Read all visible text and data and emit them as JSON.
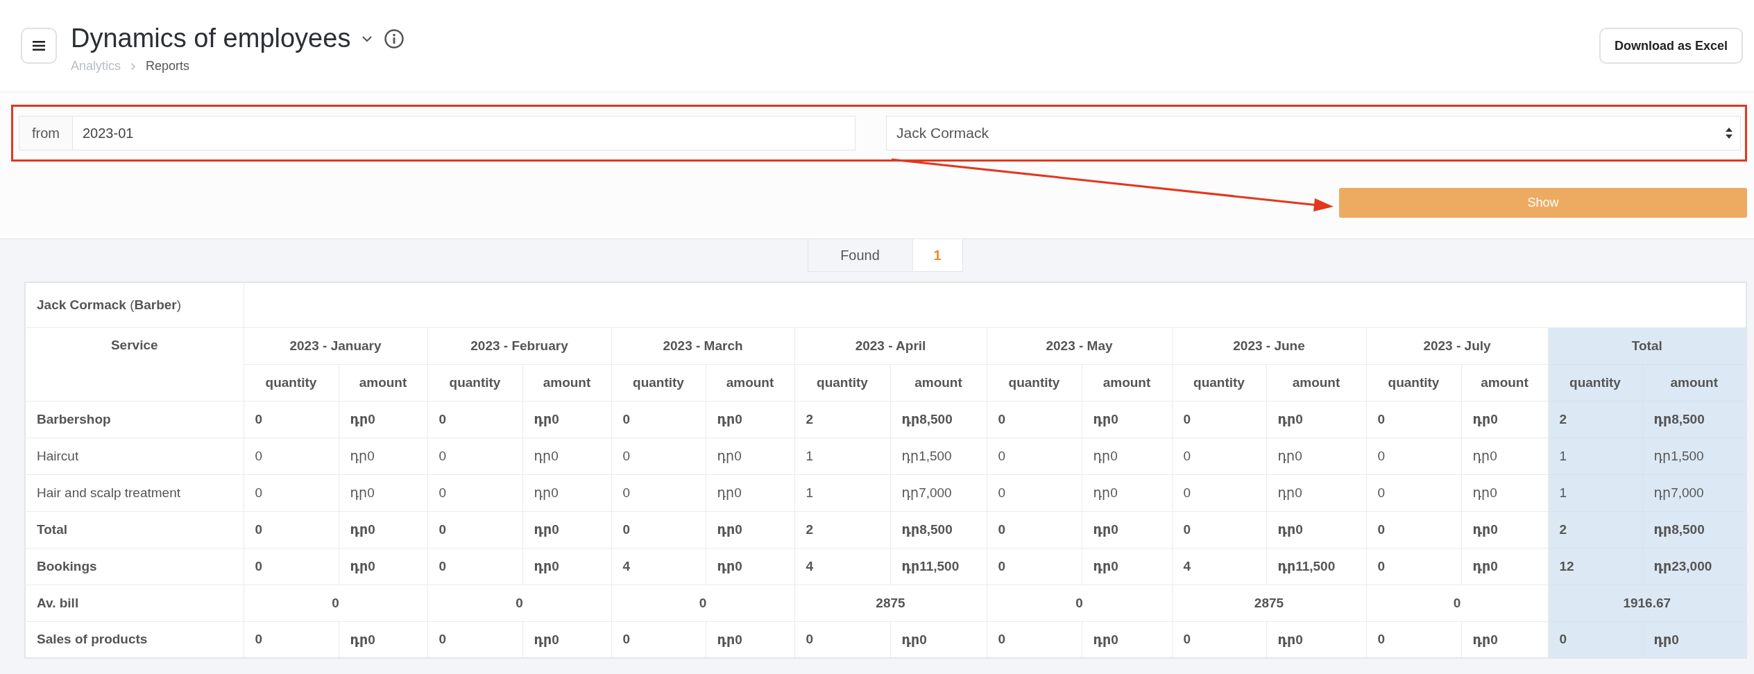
{
  "header": {
    "title": "Dynamics of employees",
    "breadcrumbs": [
      "Analytics",
      "Reports"
    ],
    "download_button": "Download as Excel"
  },
  "filters": {
    "from_label": "from",
    "from_value": "2023-01",
    "employee": "Jack Cormack",
    "show_button": "Show"
  },
  "found": {
    "label": "Found",
    "count": "1"
  },
  "table": {
    "employee": "**Jack Cormack** (**Barber**)",
    "service_header": "Service",
    "periods": [
      {
        "label": "2023 - January",
        "subheaders": [
          "quantity",
          "amount"
        ]
      },
      {
        "label": "2023 - February",
        "subheaders": [
          "quantity",
          "amount"
        ]
      },
      {
        "label": "2023 - March",
        "subheaders": [
          "quantity",
          "amount"
        ]
      },
      {
        "label": "2023 - April",
        "subheaders": [
          "quantity",
          "amount"
        ]
      },
      {
        "label": "2023 - May",
        "subheaders": [
          "quantity",
          "amount"
        ]
      },
      {
        "label": "2023 - June",
        "subheaders": [
          "quantity",
          "amount"
        ]
      },
      {
        "label": "2023 - July",
        "subheaders": [
          "quantity",
          "amount"
        ]
      },
      {
        "label": "Total",
        "subheaders": [
          "quantity",
          "amount"
        ]
      }
    ],
    "rows": [
      {
        "label": "Barbershop",
        "kind": "bold",
        "cells": [
          "0",
          "դր0",
          "0",
          "դր0",
          "0",
          "դր0",
          "2",
          "դր8,500",
          "0",
          "դր0",
          "0",
          "դր0",
          "0",
          "դր0",
          "2",
          "դր8,500"
        ]
      },
      {
        "label": "Haircut",
        "kind": "normal",
        "cells": [
          "0",
          "դր0",
          "0",
          "դր0",
          "0",
          "դր0",
          "1",
          "դր1,500",
          "0",
          "դր0",
          "0",
          "դր0",
          "0",
          "դր0",
          "1",
          "դր1,500"
        ]
      },
      {
        "label": "Hair and scalp treatment",
        "kind": "normal",
        "cells": [
          "0",
          "դր0",
          "0",
          "դր0",
          "0",
          "դր0",
          "1",
          "դր7,000",
          "0",
          "դր0",
          "0",
          "դր0",
          "0",
          "դր0",
          "1",
          "դր7,000"
        ]
      },
      {
        "label": "Total",
        "kind": "bold",
        "cells": [
          "0",
          "դր0",
          "0",
          "դր0",
          "0",
          "դր0",
          "2",
          "դր8,500",
          "0",
          "դր0",
          "0",
          "դր0",
          "0",
          "դր0",
          "2",
          "դր8,500"
        ]
      },
      {
        "label": "Bookings",
        "kind": "bold",
        "cells": [
          "0",
          "դր0",
          "0",
          "դր0",
          "4",
          "դր0",
          "4",
          "դր11,500",
          "0",
          "դր0",
          "4",
          "դր11,500",
          "0",
          "դր0",
          "12",
          "դր23,000"
        ]
      },
      {
        "label": "Av. bill",
        "kind": "merged",
        "period_values": [
          "0",
          "0",
          "0",
          "2875",
          "0",
          "2875",
          "0",
          "1916.67"
        ]
      },
      {
        "label": "Sales of products",
        "kind": "bold",
        "cells": [
          "0",
          "դր0",
          "0",
          "դր0",
          "0",
          "դր0",
          "0",
          "դր0",
          "0",
          "դր0",
          "0",
          "դր0",
          "0",
          "դր0",
          "0",
          "դր0"
        ]
      }
    ]
  }
}
